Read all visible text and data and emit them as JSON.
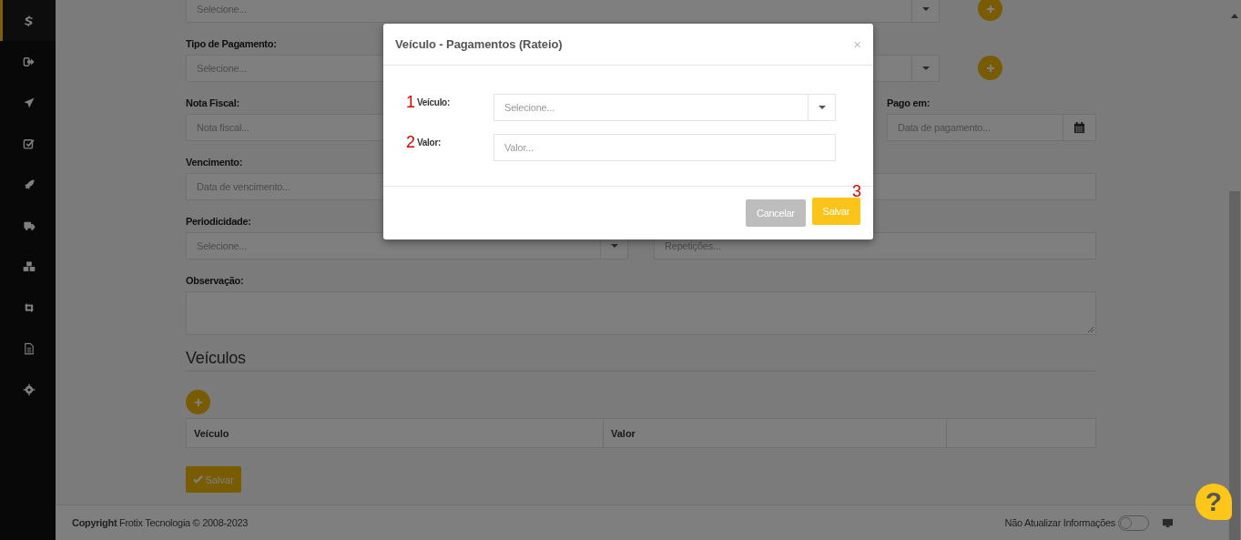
{
  "sidebar": {
    "items": [
      {
        "selected": true
      },
      {
        "selected": false
      },
      {
        "selected": false
      },
      {
        "selected": false
      },
      {
        "selected": false
      },
      {
        "selected": false
      },
      {
        "selected": false
      },
      {
        "selected": false
      },
      {
        "selected": false
      },
      {
        "selected": false
      }
    ]
  },
  "form": {
    "rows": [
      {
        "fields": [
          {
            "kind": "select",
            "placeholder": "Selecione...",
            "add": true
          }
        ]
      },
      {
        "fields": [
          {
            "kind": "select",
            "label": "Tipo de Pagamento:",
            "placeholder": "Selecione...",
            "add": true
          }
        ]
      },
      {
        "fields": [
          {
            "kind": "input",
            "label": "Nota Fiscal:",
            "placeholder": "Nota fiscal..."
          },
          {
            "kind": "date",
            "label": "Pago em:",
            "placeholder": "Data de pagamento..."
          }
        ]
      },
      {
        "fields": [
          {
            "kind": "input",
            "label": "Vencimento:",
            "placeholder": "Data de vencimento..."
          }
        ]
      },
      {
        "fields": [
          {
            "kind": "select",
            "label": "Periodicidade:",
            "placeholder": "Selecione..."
          },
          {
            "kind": "input",
            "placeholder": "Repetições..."
          }
        ]
      },
      {
        "fields": [
          {
            "kind": "textarea",
            "label": "Observação:"
          }
        ]
      }
    ],
    "section_title": "Veículos",
    "table": {
      "columns": [
        "Veículo",
        "Valor"
      ]
    },
    "save_button": "Salvar"
  },
  "footer": {
    "copyright": "**Copyright** Frotix Tecnologia © 2008-2023",
    "toggle": {
      "label": "Não Atualizar Informações",
      "on": false
    }
  },
  "help_button": "?",
  "modal": {
    "title": "Veículo - Pagamentos (Rateio)",
    "close": "×",
    "fields": [
      {
        "kind": "select",
        "marker": "1",
        "label": "Veículo:",
        "placeholder": "Selecione..."
      },
      {
        "kind": "input",
        "marker": "2",
        "label": "Valor:",
        "placeholder": "Valor..."
      }
    ],
    "buttons": [
      {
        "kind": "secondary",
        "label": "Cancelar"
      },
      {
        "kind": "primary",
        "label": "Salvar",
        "marker": "3"
      }
    ]
  }
}
